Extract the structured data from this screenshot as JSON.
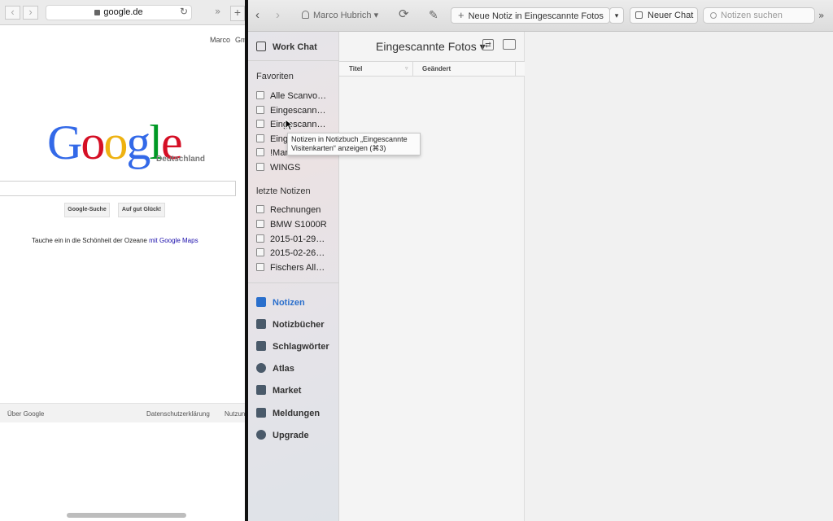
{
  "safari": {
    "url": "google.de",
    "account": "Marco",
    "gmail": "Gm",
    "logo_letters": [
      {
        "ch": "G",
        "color": "#3369e8"
      },
      {
        "ch": "o",
        "color": "#d50f25"
      },
      {
        "ch": "o",
        "color": "#eeb211"
      },
      {
        "ch": "g",
        "color": "#3369e8"
      },
      {
        "ch": "l",
        "color": "#009925"
      },
      {
        "ch": "e",
        "color": "#d50f25"
      }
    ],
    "logo_sub": "Deutschland",
    "search_button": "Google-Suche",
    "lucky_button": "Auf gut Glück!",
    "promo_text": "Tauche ein in die Schönheit der Ozeane",
    "promo_link": "mit Google Maps",
    "footer": {
      "about": "Über Google",
      "privacy": "Datenschutzerklärung",
      "terms": "Nutzun"
    }
  },
  "evernote": {
    "toolbar": {
      "user": "Marco Hubrich ▾",
      "new_note": "Neue Notiz in Eingescannte Fotos",
      "new_chat": "Neuer Chat",
      "search_placeholder": "Notizen suchen"
    },
    "sidebar": {
      "work_chat": "Work Chat",
      "favorites_header": "Favoriten",
      "favorites": [
        "Alle Scanvo…",
        "Eingescann…",
        "Eingescann…",
        "Eing",
        "!Marco Hub…",
        "WINGS"
      ],
      "recent_header": "letzte Notizen",
      "recent": [
        "Rechnungen",
        "BMW S1000R",
        "2015-01-29…",
        "2015-02-26…",
        "Fischers All…"
      ],
      "main": [
        {
          "label": "Notizen",
          "icon": "note-icon",
          "active": true
        },
        {
          "label": "Notizbücher",
          "icon": "notebook-icon",
          "active": false
        },
        {
          "label": "Schlagwörter",
          "icon": "tag-icon",
          "active": false
        },
        {
          "label": "Atlas",
          "icon": "globe-icon",
          "active": false
        },
        {
          "label": "Market",
          "icon": "market-icon",
          "active": false
        },
        {
          "label": "Meldungen",
          "icon": "megaphone-icon",
          "active": false
        },
        {
          "label": "Upgrade",
          "icon": "upgrade-icon",
          "active": false
        }
      ]
    },
    "notelist": {
      "title": "Eingescannte Fotos ▾",
      "col_title": "Titel",
      "col_changed": "Geändert"
    },
    "tooltip": "Notizen in Notizbuch „Eingescannte Visitenkarten“ anzeigen (⌘3)",
    "colors": {
      "active_blue": "#2a6fcc"
    }
  }
}
